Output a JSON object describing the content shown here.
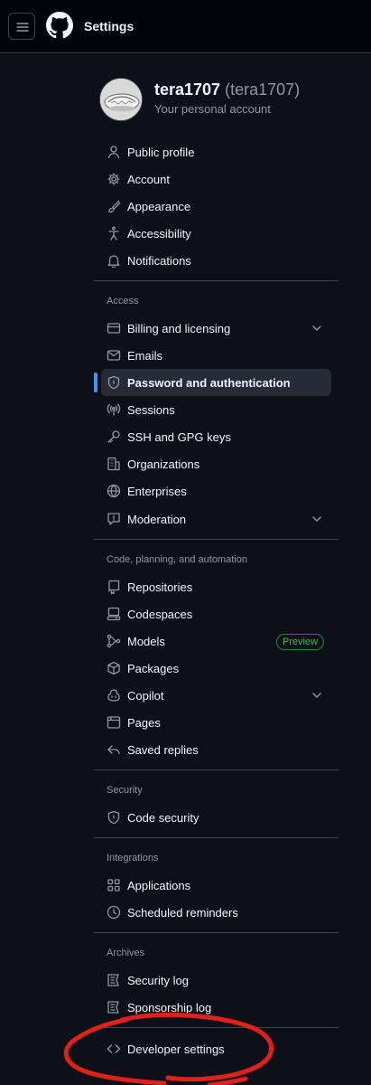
{
  "header": {
    "title": "Settings"
  },
  "profile": {
    "username": "tera1707",
    "handle": "(tera1707)",
    "subtitle": "Your personal account"
  },
  "nav": {
    "general": [
      {
        "label": "Public profile",
        "icon": "person-icon"
      },
      {
        "label": "Account",
        "icon": "gear-icon"
      },
      {
        "label": "Appearance",
        "icon": "paintbrush-icon"
      },
      {
        "label": "Accessibility",
        "icon": "accessibility-icon"
      },
      {
        "label": "Notifications",
        "icon": "bell-icon"
      }
    ],
    "access": {
      "heading": "Access",
      "items": [
        {
          "label": "Billing and licensing",
          "icon": "credit-card-icon",
          "expandable": true
        },
        {
          "label": "Emails",
          "icon": "mail-icon"
        },
        {
          "label": "Password and authentication",
          "icon": "shield-lock-icon",
          "active": true
        },
        {
          "label": "Sessions",
          "icon": "broadcast-icon"
        },
        {
          "label": "SSH and GPG keys",
          "icon": "key-icon"
        },
        {
          "label": "Organizations",
          "icon": "organization-icon"
        },
        {
          "label": "Enterprises",
          "icon": "globe-icon"
        },
        {
          "label": "Moderation",
          "icon": "report-icon",
          "expandable": true
        }
      ]
    },
    "code": {
      "heading": "Code, planning, and automation",
      "items": [
        {
          "label": "Repositories",
          "icon": "repo-icon"
        },
        {
          "label": "Codespaces",
          "icon": "codespaces-icon"
        },
        {
          "label": "Models",
          "icon": "models-icon",
          "badge": "Preview"
        },
        {
          "label": "Packages",
          "icon": "package-icon"
        },
        {
          "label": "Copilot",
          "icon": "copilot-icon",
          "expandable": true
        },
        {
          "label": "Pages",
          "icon": "browser-icon"
        },
        {
          "label": "Saved replies",
          "icon": "reply-icon"
        }
      ]
    },
    "security": {
      "heading": "Security",
      "items": [
        {
          "label": "Code security",
          "icon": "shield-lock-icon"
        }
      ]
    },
    "integrations": {
      "heading": "Integrations",
      "items": [
        {
          "label": "Applications",
          "icon": "apps-icon"
        },
        {
          "label": "Scheduled reminders",
          "icon": "clock-icon"
        }
      ]
    },
    "archives": {
      "heading": "Archives",
      "items": [
        {
          "label": "Security log",
          "icon": "log-icon"
        },
        {
          "label": "Sponsorship log",
          "icon": "log-icon"
        }
      ]
    },
    "developer": {
      "label": "Developer settings",
      "icon": "code-icon"
    }
  },
  "colors": {
    "accent": "#4493f8",
    "background": "#0d1117",
    "annotation": "#e0201a",
    "badge": "#3fb950"
  }
}
